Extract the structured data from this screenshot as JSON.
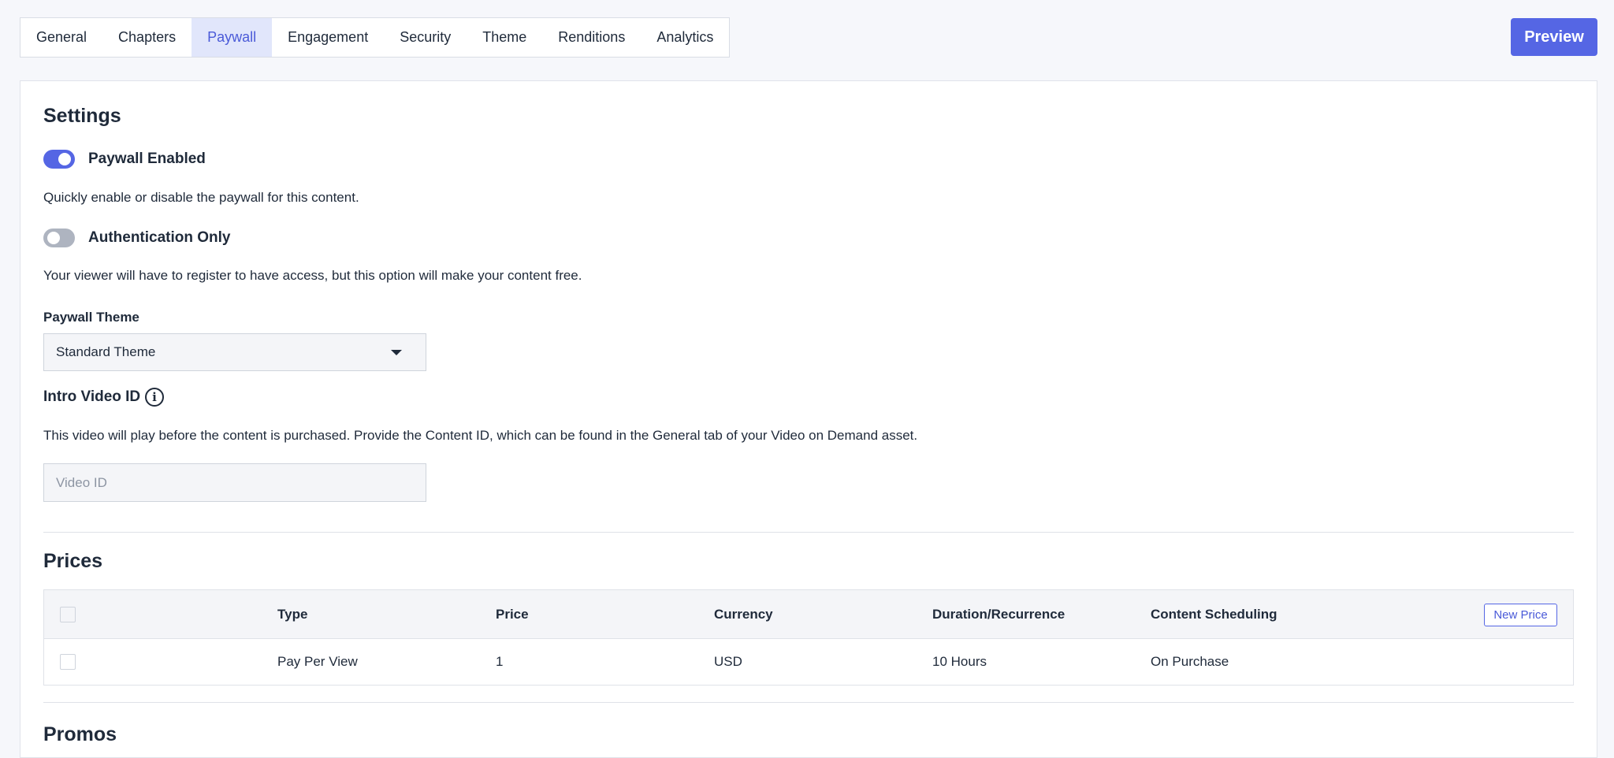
{
  "tabs": [
    {
      "label": "General",
      "active": false
    },
    {
      "label": "Chapters",
      "active": false
    },
    {
      "label": "Paywall",
      "active": true
    },
    {
      "label": "Engagement",
      "active": false
    },
    {
      "label": "Security",
      "active": false
    },
    {
      "label": "Theme",
      "active": false
    },
    {
      "label": "Renditions",
      "active": false
    },
    {
      "label": "Analytics",
      "active": false
    }
  ],
  "preview_label": "Preview",
  "settings": {
    "title": "Settings",
    "paywall_enabled": {
      "label": "Paywall Enabled",
      "on": true,
      "description": "Quickly enable or disable the paywall for this content."
    },
    "auth_only": {
      "label": "Authentication Only",
      "on": false,
      "description": "Your viewer will have to register to have access, but this option will make your content free."
    },
    "paywall_theme": {
      "label": "Paywall Theme",
      "selected": "Standard Theme"
    },
    "intro_video": {
      "label": "Intro Video ID",
      "description": "This video will play before the content is purchased. Provide the Content ID, which can be found in the General tab of your Video on Demand asset.",
      "placeholder": "Video ID",
      "value": ""
    }
  },
  "prices": {
    "title": "Prices",
    "columns": [
      "Type",
      "Price",
      "Currency",
      "Duration/Recurrence",
      "Content Scheduling"
    ],
    "new_price_label": "New Price",
    "rows": [
      [
        "Pay Per View",
        "1",
        "USD",
        "10 Hours",
        "On Purchase"
      ]
    ]
  },
  "promos": {
    "title": "Promos"
  },
  "colors": {
    "accent": "#5566e4",
    "active_tab_bg": "#e1e6fb",
    "toggle_off": "#aeb4c0"
  },
  "icons": {
    "info": "info-circle-icon",
    "dropdown": "caret-down-icon"
  }
}
